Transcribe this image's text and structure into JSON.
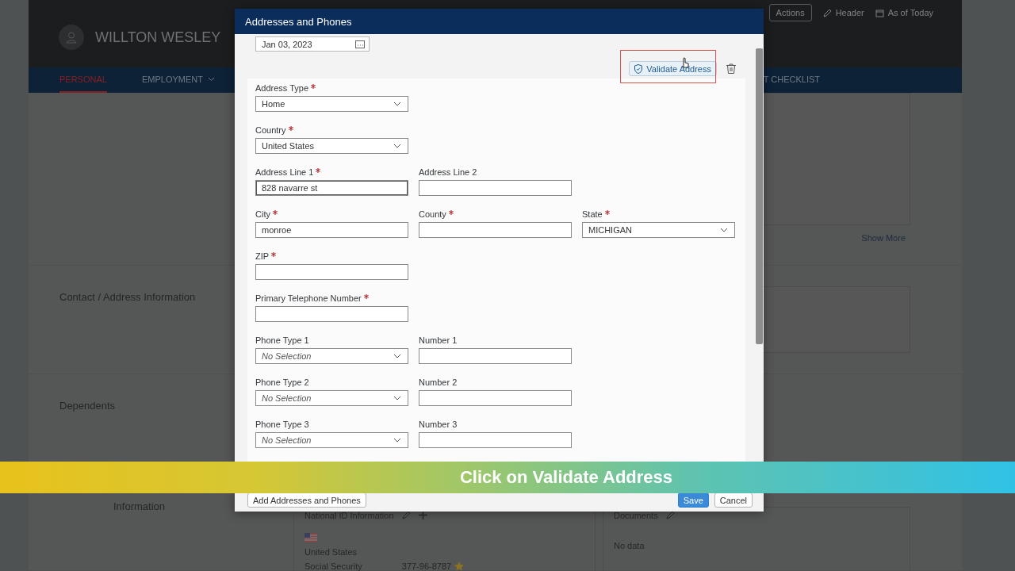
{
  "page": {
    "employee_name": "WILLTON WESLEY",
    "header_actions": [
      {
        "kind": "button",
        "label": "Actions"
      },
      {
        "kind": "edit",
        "label": "Header"
      },
      {
        "kind": "calendar",
        "label": "As of Today"
      }
    ],
    "nav_tabs": [
      {
        "label": "PERSONAL",
        "selected": true,
        "dropdown": false
      },
      {
        "label": "EMPLOYMENT",
        "selected": false,
        "dropdown": true
      },
      {
        "label": "T CHECKLIST",
        "selected": false,
        "dropdown": false
      }
    ],
    "show_more": "Show More",
    "sections": [
      {
        "title": "Contact / Address Information"
      },
      {
        "title": "Dependents"
      },
      {
        "title": "Information"
      }
    ],
    "national_id": {
      "title": "National ID Information",
      "country": "United States",
      "type": "Social Security",
      "number": "377-96-8787",
      "primary": true
    },
    "documents": {
      "title": "Documents",
      "empty_text": "No data"
    }
  },
  "dialog": {
    "title": "Addresses and Phones",
    "effective_date": "Jan 03, 2023",
    "validate_button": "Validate Address",
    "validate_highlighted": true,
    "form_rows": [
      [
        {
          "kind": "select",
          "label": "Address Type",
          "required": true,
          "value": "Home"
        }
      ],
      [
        {
          "kind": "select",
          "label": "Country",
          "required": true,
          "value": "United States"
        }
      ],
      [
        {
          "kind": "text",
          "label": "Address Line 1",
          "required": true,
          "value": "828 navarre st",
          "focused": true
        },
        {
          "kind": "text",
          "label": "Address Line 2",
          "required": false
        }
      ],
      [
        {
          "kind": "text",
          "label": "City",
          "required": true,
          "value": "monroe"
        },
        {
          "kind": "text",
          "label": "County",
          "required": true
        },
        {
          "kind": "select",
          "label": "State",
          "required": true,
          "value": "MICHIGAN"
        }
      ],
      [
        {
          "kind": "text",
          "label": "ZIP",
          "required": true
        }
      ],
      [
        {
          "kind": "text",
          "label": "Primary Telephone Number",
          "required": true
        }
      ],
      [
        {
          "kind": "select",
          "label": "Phone Type 1",
          "required": false,
          "placeholder": "No Selection"
        },
        {
          "kind": "text",
          "label": "Number 1",
          "required": false
        }
      ],
      [
        {
          "kind": "select",
          "label": "Phone Type 2",
          "required": false,
          "placeholder": "No Selection"
        },
        {
          "kind": "text",
          "label": "Number 2",
          "required": false
        }
      ],
      [
        {
          "kind": "select",
          "label": "Phone Type 3",
          "required": false,
          "placeholder": "No Selection"
        },
        {
          "kind": "text",
          "label": "Number 3",
          "required": false
        }
      ]
    ],
    "add_button": "Add Addresses and Phones",
    "buttons": [
      {
        "kind": "primary",
        "label": "Save"
      },
      {
        "kind": "secondary",
        "label": "Cancel"
      }
    ]
  },
  "caption": "Click on Validate Address"
}
